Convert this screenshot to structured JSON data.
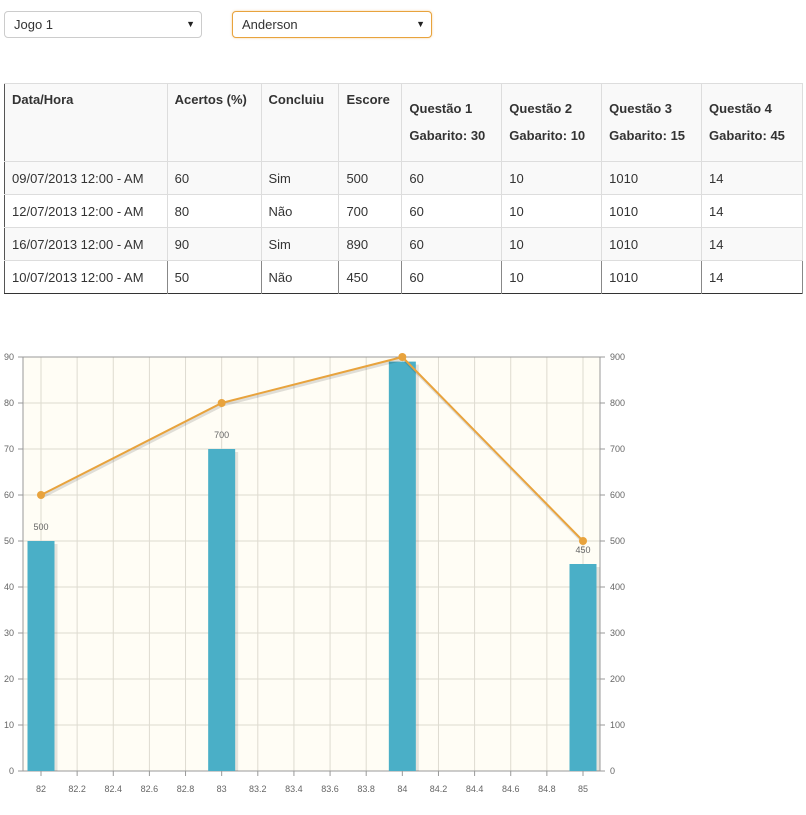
{
  "filters": {
    "game": "Jogo 1",
    "player": "Anderson"
  },
  "table": {
    "headers": {
      "datetime": "Data/Hora",
      "hits": "Acertos (%)",
      "completed": "Concluiu",
      "score": "Escore"
    },
    "questions": [
      {
        "title": "Questão 1",
        "key": "Gabarito: 30"
      },
      {
        "title": "Questão 2",
        "key": "Gabarito: 10"
      },
      {
        "title": "Questão 3",
        "key": "Gabarito: 15"
      },
      {
        "title": "Questão 4",
        "key": "Gabarito: 45"
      }
    ],
    "rows": [
      {
        "datetime": "09/07/2013 12:00 - AM",
        "hits": "60",
        "completed": "Sim",
        "score": "500",
        "q": [
          "60",
          "10",
          "1010",
          "14"
        ]
      },
      {
        "datetime": "12/07/2013 12:00 - AM",
        "hits": "80",
        "completed": "Não",
        "score": "700",
        "q": [
          "60",
          "10",
          "1010",
          "14"
        ]
      },
      {
        "datetime": "16/07/2013 12:00 - AM",
        "hits": "90",
        "completed": "Sim",
        "score": "890",
        "q": [
          "60",
          "10",
          "1010",
          "14"
        ]
      },
      {
        "datetime": "10/07/2013 12:00 - AM",
        "hits": "50",
        "completed": "Não",
        "score": "450",
        "q": [
          "60",
          "10",
          "1010",
          "14"
        ]
      }
    ]
  },
  "chart_data": {
    "type": "bar",
    "x": [
      82,
      83,
      84,
      85
    ],
    "xlim": [
      82,
      85
    ],
    "x_ticks": [
      "82",
      "82.2",
      "82.4",
      "82.6",
      "82.8",
      "83",
      "83.2",
      "83.4",
      "83.6",
      "83.8",
      "84",
      "84.2",
      "84.4",
      "84.6",
      "84.8",
      "85"
    ],
    "left_axis": {
      "ylim": [
        0,
        90
      ],
      "ticks": [
        "0",
        "10",
        "20",
        "30",
        "40",
        "50",
        "60",
        "70",
        "80",
        "90"
      ]
    },
    "right_axis": {
      "ylim": [
        0,
        900
      ],
      "ticks": [
        "0",
        "100",
        "200",
        "300",
        "400",
        "500",
        "600",
        "700",
        "800",
        "900"
      ]
    },
    "series": [
      {
        "type": "bar",
        "axis": "left",
        "values": [
          50,
          70,
          89,
          45
        ],
        "labels": [
          "500",
          "700",
          "",
          "450"
        ],
        "color": "#4aafc7"
      },
      {
        "type": "line",
        "axis": "right",
        "values": [
          600,
          800,
          900,
          500
        ],
        "color": "#e8a33d"
      }
    ],
    "grid": true,
    "background": "#fffdf5"
  }
}
